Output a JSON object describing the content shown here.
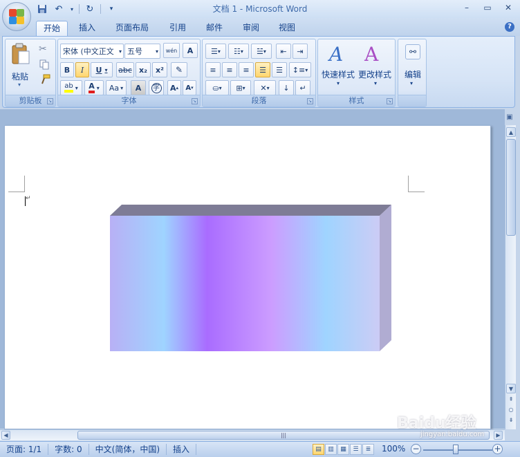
{
  "window": {
    "title": "文档 1 - Microsoft Word",
    "controls": [
      "minimize",
      "maximize",
      "close"
    ]
  },
  "quick_access": [
    "save-icon",
    "undo-icon",
    "redo-icon",
    "customize-icon"
  ],
  "tabs": [
    {
      "label": "开始",
      "active": true
    },
    {
      "label": "插入"
    },
    {
      "label": "页面布局"
    },
    {
      "label": "引用"
    },
    {
      "label": "邮件"
    },
    {
      "label": "审阅"
    },
    {
      "label": "视图"
    }
  ],
  "ribbon": {
    "clipboard": {
      "label": "剪贴板",
      "paste_label": "粘贴"
    },
    "font": {
      "label": "字体",
      "font_name": "宋体 (中文正文",
      "font_size": "五号",
      "wen_button": "wén",
      "bold": "B",
      "italic": "I",
      "underline": "U",
      "strike": "abc",
      "subscript": "x₂",
      "superscript": "x²",
      "change_case": "Aa",
      "char_border": "A",
      "enclose": "字",
      "grow": "A",
      "shrink": "A",
      "font_color_letter": "A",
      "highlight_letter": "ab"
    },
    "paragraph": {
      "label": "段落"
    },
    "styles": {
      "label": "样式",
      "quick_styles": "快速样式",
      "change_styles": "更改样式"
    },
    "editing": {
      "label": "编辑"
    }
  },
  "status": {
    "page": "页面: 1/1",
    "words": "字数: 0",
    "language": "中文(简体，中国)",
    "mode": "插入",
    "zoom": "100%",
    "zoom_level": 1.0
  },
  "watermark": {
    "main": "Baidu经验",
    "sub": "jingyan.baidu.com"
  },
  "colors": {
    "ribbon_accent": "#15428b",
    "shape_gradient": [
      "#b8b0f5",
      "#9fd4ff",
      "#a96cff",
      "#cc9dff",
      "#9fd4ff",
      "#ccccf5"
    ],
    "shape_top": "#7e7c96",
    "shape_side": "#b0acd2"
  }
}
